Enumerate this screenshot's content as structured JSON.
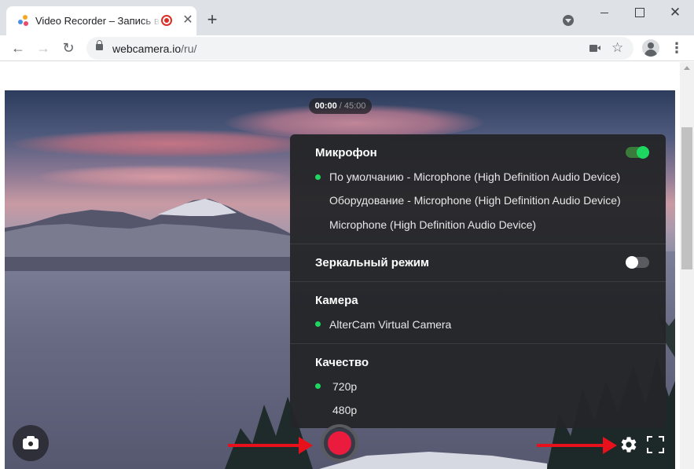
{
  "browser": {
    "tab_title": "Video Recorder – Запись видео",
    "tab_close": "✕",
    "new_tab": "+",
    "url_domain": "webcamera.io",
    "url_path": "/ru/",
    "icons": [
      "back-arrow-icon",
      "forward-arrow-icon",
      "reload-icon",
      "lock-icon",
      "camera-icon",
      "star-icon",
      "profile-icon",
      "menu-dots-icon"
    ]
  },
  "window_controls": {
    "close": "✕"
  },
  "nav": {
    "back": "←",
    "forward": "→",
    "reload": "↻",
    "star": "☆",
    "menu": "⋮"
  },
  "player": {
    "time_current": "00:00",
    "time_separator": " / ",
    "time_total": "45:00"
  },
  "settings": {
    "microphone": {
      "title": "Микрофон",
      "enabled": true,
      "options": [
        {
          "label": "По умолчанию - Microphone (High Definition Audio Device)",
          "selected": true
        },
        {
          "label": "Оборудование - Microphone (High Definition Audio Device)",
          "selected": false
        },
        {
          "label": "Microphone (High Definition Audio Device)",
          "selected": false
        }
      ]
    },
    "mirror": {
      "title": "Зеркальный режим",
      "enabled": false
    },
    "camera": {
      "title": "Камера",
      "options": [
        {
          "label": "AlterCam Virtual Camera",
          "selected": true
        }
      ]
    },
    "quality": {
      "title": "Качество",
      "options": [
        {
          "label": "720p",
          "selected": true
        },
        {
          "label": "480p",
          "selected": false
        }
      ]
    }
  },
  "colors": {
    "accent_green": "#1ed760",
    "record_red": "#ea1b3c",
    "annotation_arrow": "#e8101a",
    "panel_bg": "#242529"
  }
}
